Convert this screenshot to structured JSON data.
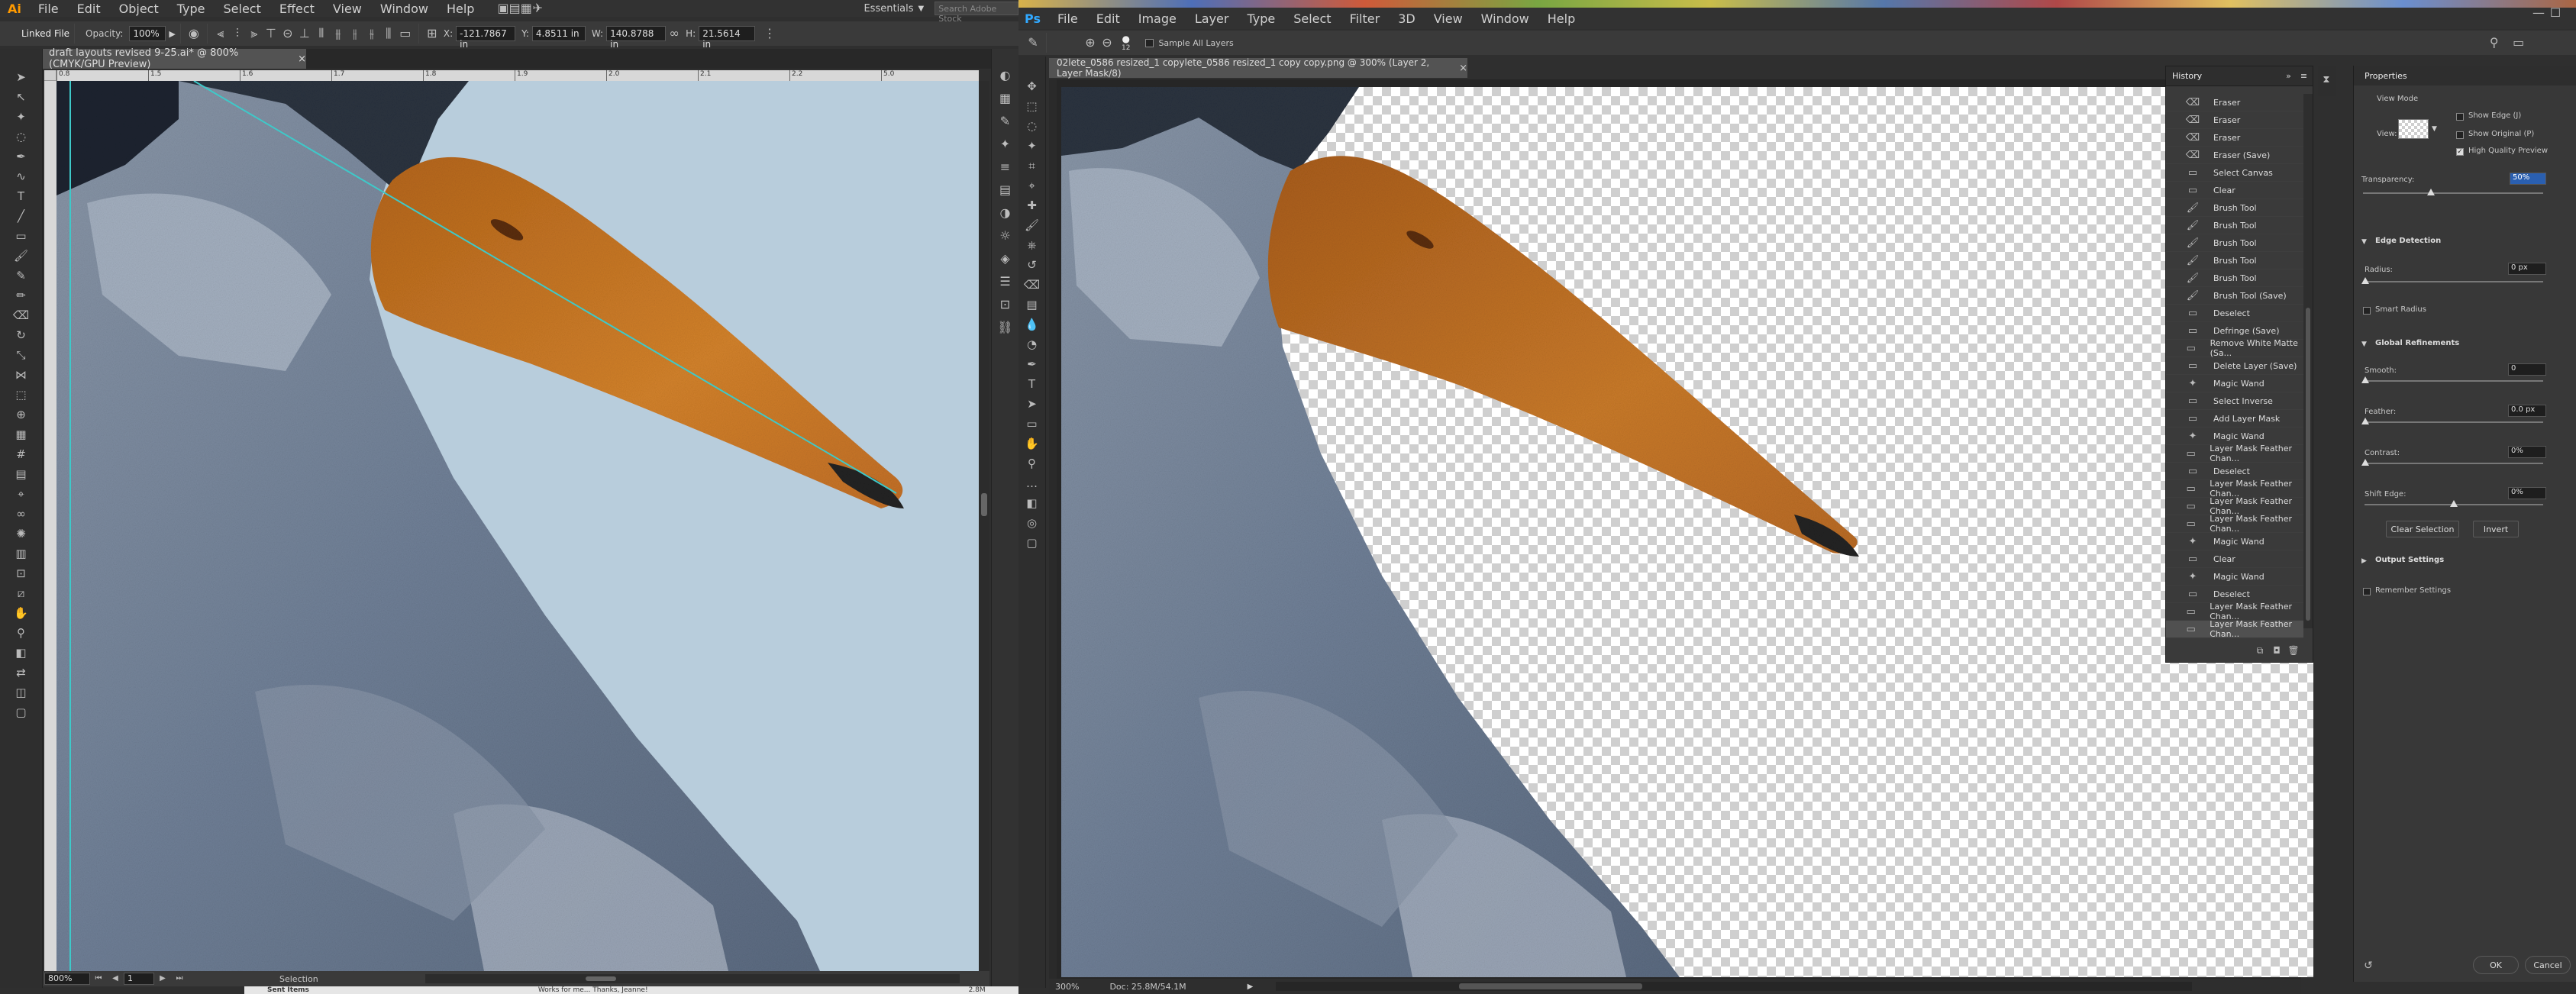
{
  "illustrator": {
    "logo": "Ai",
    "menu": [
      "File",
      "Edit",
      "Object",
      "Type",
      "Select",
      "Effect",
      "View",
      "Window",
      "Help"
    ],
    "workspace": "Essentials",
    "search_placeholder": "Search Adobe Stock",
    "control": {
      "linked_file": "Linked File",
      "opacity_label": "Opacity:",
      "opacity_value": "100%",
      "x_label": "X:",
      "x_value": "-121.7867 in",
      "y_label": "Y:",
      "y_value": "4.8511 in",
      "w_label": "W:",
      "w_value": "140.8788 in",
      "h_label": "H:",
      "h_value": "21.5614 in"
    },
    "doc_tab": "draft layouts revised 9-25.ai* @ 800% (CMYK/GPU Preview)",
    "ruler_ticks": [
      "0.8",
      "1.5",
      "1.6",
      "1.7",
      "1.8",
      "1.9",
      "2.0",
      "2.1",
      "2.2",
      "5.0"
    ],
    "status": {
      "zoom": "800%",
      "page": "1",
      "tool": "Selection"
    }
  },
  "taskbar": {
    "item1": "Sent Items",
    "item2": "Works for me... Thanks, Jeanne!",
    "item3": "2.8M"
  },
  "photoshop": {
    "logo": "Ps",
    "menu": [
      "File",
      "Edit",
      "Image",
      "Layer",
      "Type",
      "Select",
      "Filter",
      "3D",
      "View",
      "Window",
      "Help"
    ],
    "options": {
      "brush_size": "12",
      "sample_all_layers": "Sample All Layers"
    },
    "doc_tab": "02lete_0586 resized_1 copylete_0586 resized_1 copy copy.png @ 300% (Layer 2, Layer Mask/8)",
    "status": {
      "zoom": "300%",
      "doc": "Doc: 25.8M/54.1M"
    },
    "history": {
      "title": "History",
      "items": [
        {
          "icon": "eraser",
          "label": "Eraser"
        },
        {
          "icon": "eraser",
          "label": "Eraser"
        },
        {
          "icon": "eraser",
          "label": "Eraser"
        },
        {
          "icon": "eraser",
          "label": "Eraser (Save)"
        },
        {
          "icon": "doc",
          "label": "Select Canvas"
        },
        {
          "icon": "doc",
          "label": "Clear"
        },
        {
          "icon": "brush",
          "label": "Brush Tool"
        },
        {
          "icon": "brush",
          "label": "Brush Tool"
        },
        {
          "icon": "brush",
          "label": "Brush Tool"
        },
        {
          "icon": "brush",
          "label": "Brush Tool"
        },
        {
          "icon": "brush",
          "label": "Brush Tool"
        },
        {
          "icon": "brush",
          "label": "Brush Tool (Save)"
        },
        {
          "icon": "doc",
          "label": "Deselect"
        },
        {
          "icon": "doc",
          "label": "Defringe (Save)"
        },
        {
          "icon": "doc",
          "label": "Remove White Matte (Sa..."
        },
        {
          "icon": "doc",
          "label": "Delete Layer (Save)"
        },
        {
          "icon": "wand",
          "label": "Magic Wand"
        },
        {
          "icon": "doc",
          "label": "Select Inverse"
        },
        {
          "icon": "doc",
          "label": "Add Layer Mask"
        },
        {
          "icon": "wand",
          "label": "Magic Wand"
        },
        {
          "icon": "doc",
          "label": "Layer Mask Feather Chan..."
        },
        {
          "icon": "doc",
          "label": "Deselect"
        },
        {
          "icon": "doc",
          "label": "Layer Mask Feather Chan..."
        },
        {
          "icon": "doc",
          "label": "Layer Mask Feather Chan..."
        },
        {
          "icon": "doc",
          "label": "Layer Mask Feather Chan..."
        },
        {
          "icon": "wand",
          "label": "Magic Wand"
        },
        {
          "icon": "doc",
          "label": "Clear"
        },
        {
          "icon": "wand",
          "label": "Magic Wand"
        },
        {
          "icon": "doc",
          "label": "Deselect"
        },
        {
          "icon": "doc",
          "label": "Layer Mask Feather Chan..."
        },
        {
          "icon": "doc",
          "label": "Layer Mask Feather Chan..."
        }
      ]
    },
    "properties": {
      "title": "Properties",
      "view_mode": "View Mode",
      "view_label": "View:",
      "show_edge": "Show Edge (J)",
      "show_original": "Show Original (P)",
      "high_quality": "High Quality Preview",
      "transparency_label": "Transparency:",
      "transparency_value": "50%",
      "edge_detection": "Edge Detection",
      "radius_label": "Radius:",
      "radius_value": "0 px",
      "smart_radius": "Smart Radius",
      "global_refinements": "Global Refinements",
      "smooth_label": "Smooth:",
      "smooth_value": "0",
      "feather_label": "Feather:",
      "feather_value": "0.0 px",
      "contrast_label": "Contrast:",
      "contrast_value": "0%",
      "shift_edge_label": "Shift Edge:",
      "shift_edge_value": "0%",
      "clear_selection": "Clear Selection",
      "invert": "Invert",
      "output_settings": "Output Settings",
      "remember_settings": "Remember Settings",
      "ok": "OK",
      "cancel": "Cancel"
    }
  },
  "colors": {
    "ai_canvas_bg": "#b8cddc",
    "beak": "#c7701f",
    "bird": "#7f8ea3",
    "guide": "#3ec9c9"
  }
}
